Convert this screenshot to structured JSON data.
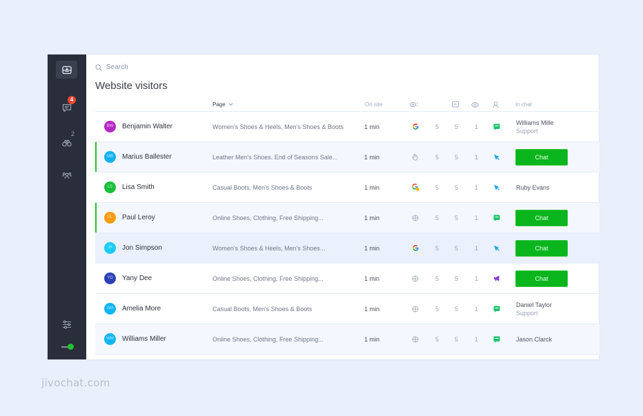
{
  "brand": "jivochat.com",
  "sidebar": {
    "items": [
      {
        "icon": "inbox-icon",
        "active": true
      },
      {
        "icon": "chat-bubble-icon",
        "badge": "4"
      },
      {
        "icon": "binoculars-icon",
        "count": "2"
      },
      {
        "icon": "team-icon"
      }
    ],
    "settings_icon": "sliders-icon",
    "status_toggle": "online"
  },
  "search": {
    "placeholder": "Search"
  },
  "page_title": "Website visitors",
  "table": {
    "headers": {
      "page": "Page",
      "on_site": "On site",
      "source_icon": "source-icon",
      "chats_icon": "chats-icon",
      "views_icon": "views-icon",
      "visits_icon": "visits-icon",
      "in_chat": "In chat"
    },
    "rows": [
      {
        "initials": "BW",
        "avatar_color": "#b42ac4",
        "name": "Benjamin Walter",
        "page": "Women's Shoes & Heels, Men's Shoes & Boots",
        "on_site": "1 min",
        "source": "google",
        "chats": "5",
        "views": "5",
        "visits": "1",
        "status": "chat",
        "in_chat": "Williams Mille",
        "in_chat_sub": "Support",
        "chat_button": null,
        "highlight": false,
        "bg": "white"
      },
      {
        "initials": "MB",
        "avatar_color": "#10b1f5",
        "name": "Marius Ballester",
        "page": "Leather Men's Shoes. End of Seasons Sale...",
        "on_site": "1 min",
        "source": "hand",
        "chats": "5",
        "views": "5",
        "visits": "1",
        "status": "cursor",
        "in_chat": null,
        "in_chat_sub": null,
        "chat_button": "Chat",
        "highlight": true,
        "bg": "light"
      },
      {
        "initials": "LS",
        "avatar_color": "#16c13a",
        "name": "Lisa Smith",
        "page": "Casual Boots, Men's Shoes & Boots",
        "on_site": "1 min",
        "source": "google-ads",
        "chats": "5",
        "views": "5",
        "visits": "1",
        "status": "cursor",
        "in_chat": "Ruby Evans",
        "in_chat_sub": null,
        "chat_button": null,
        "highlight": false,
        "bg": "white"
      },
      {
        "initials": "PL",
        "avatar_color": "#fb9a0b",
        "name": "Paul Leroy",
        "page": "Online Shoes, Clothing, Free Shipping...",
        "on_site": "1 min",
        "source": "direct",
        "chats": "5",
        "views": "5",
        "visits": "1",
        "status": "chat",
        "in_chat": null,
        "in_chat_sub": null,
        "chat_button": "Chat",
        "highlight": true,
        "bg": "light"
      },
      {
        "initials": "JS",
        "avatar_color": "#18ccf8",
        "name": "Jon Simpson",
        "page": "Women's Shoes & Heels, Men's Shoes...",
        "on_site": "1 min",
        "source": "google",
        "chats": "5",
        "views": "5",
        "visits": "1",
        "status": "cursor",
        "in_chat": null,
        "in_chat_sub": null,
        "chat_button": "Chat",
        "highlight": false,
        "bg": "blue"
      },
      {
        "initials": "YD",
        "avatar_color": "#2c41b5",
        "name": "Yany Dee",
        "page": "Online Shoes, Clothing, Free Shipping...",
        "on_site": "1 min",
        "source": "direct",
        "chats": "5",
        "views": "5",
        "visits": "1",
        "status": "megaphone",
        "in_chat": null,
        "in_chat_sub": null,
        "chat_button": "Chat",
        "highlight": false,
        "bg": "white"
      },
      {
        "initials": "AM",
        "avatar_color": "#0eb5f6",
        "name": "Amelia More",
        "page": "Casual Boots, Men's Shoes & Boots",
        "on_site": "1 min",
        "source": "direct",
        "chats": "5",
        "views": "5",
        "visits": "1",
        "status": "chat",
        "in_chat": "Daniel Taylor",
        "in_chat_sub": "Support",
        "chat_button": null,
        "highlight": false,
        "bg": "white"
      },
      {
        "initials": "WM",
        "avatar_color": "#0eb5f6",
        "name": "Williams Miller",
        "page": "Online Shoes, Clothing, Free Shipping...",
        "on_site": "1 min",
        "source": "direct",
        "chats": "5",
        "views": "5",
        "visits": "1",
        "status": "chat",
        "in_chat": "Jason Clarck",
        "in_chat_sub": null,
        "chat_button": null,
        "highlight": false,
        "bg": "light"
      }
    ]
  },
  "colors": {
    "accent_green": "#0bb51d",
    "sidebar_bg": "#2a2e3b",
    "badge_red": "#f0442f",
    "status_chat": "#1ec56b",
    "status_cursor": "#1aa3ef",
    "status_megaphone": "#8b3fd8"
  }
}
